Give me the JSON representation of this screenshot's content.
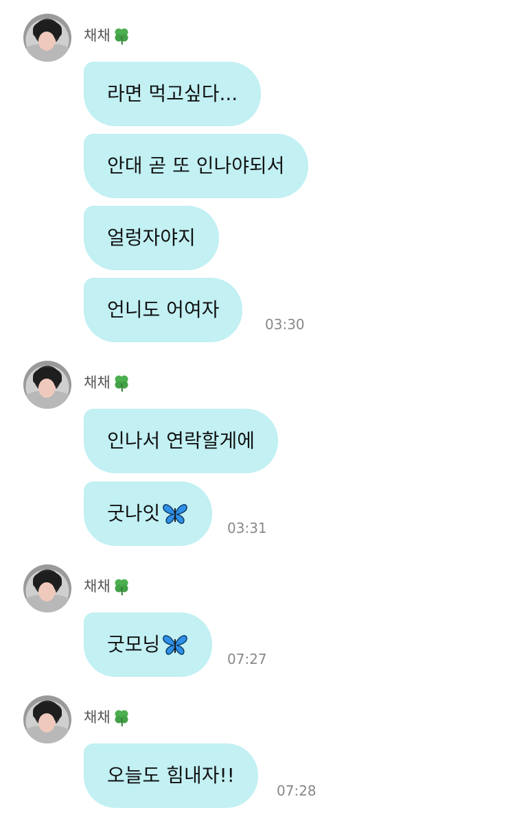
{
  "groups": [
    {
      "sender": "채채",
      "messages": [
        "라면 먹고싶다...",
        "안대 곧 또 인나야되서",
        "얼렁자야지",
        "언니도 어여자"
      ],
      "time": "03:30"
    },
    {
      "sender": "채채",
      "messages": [
        "인나서 연락할게에",
        "굿나잇"
      ],
      "time": "03:31"
    },
    {
      "sender": "채채",
      "messages": [
        "굿모닝"
      ],
      "time": "07:27"
    },
    {
      "sender": "채채",
      "messages": [
        "오늘도 힘내자!!"
      ],
      "time": "07:28"
    }
  ],
  "icons": {
    "name_suffix": "clover-icon",
    "message_suffix": "butterfly-icon"
  },
  "colors": {
    "bubble": "#c2f0f3",
    "time": "#888888",
    "sender": "#555555"
  }
}
